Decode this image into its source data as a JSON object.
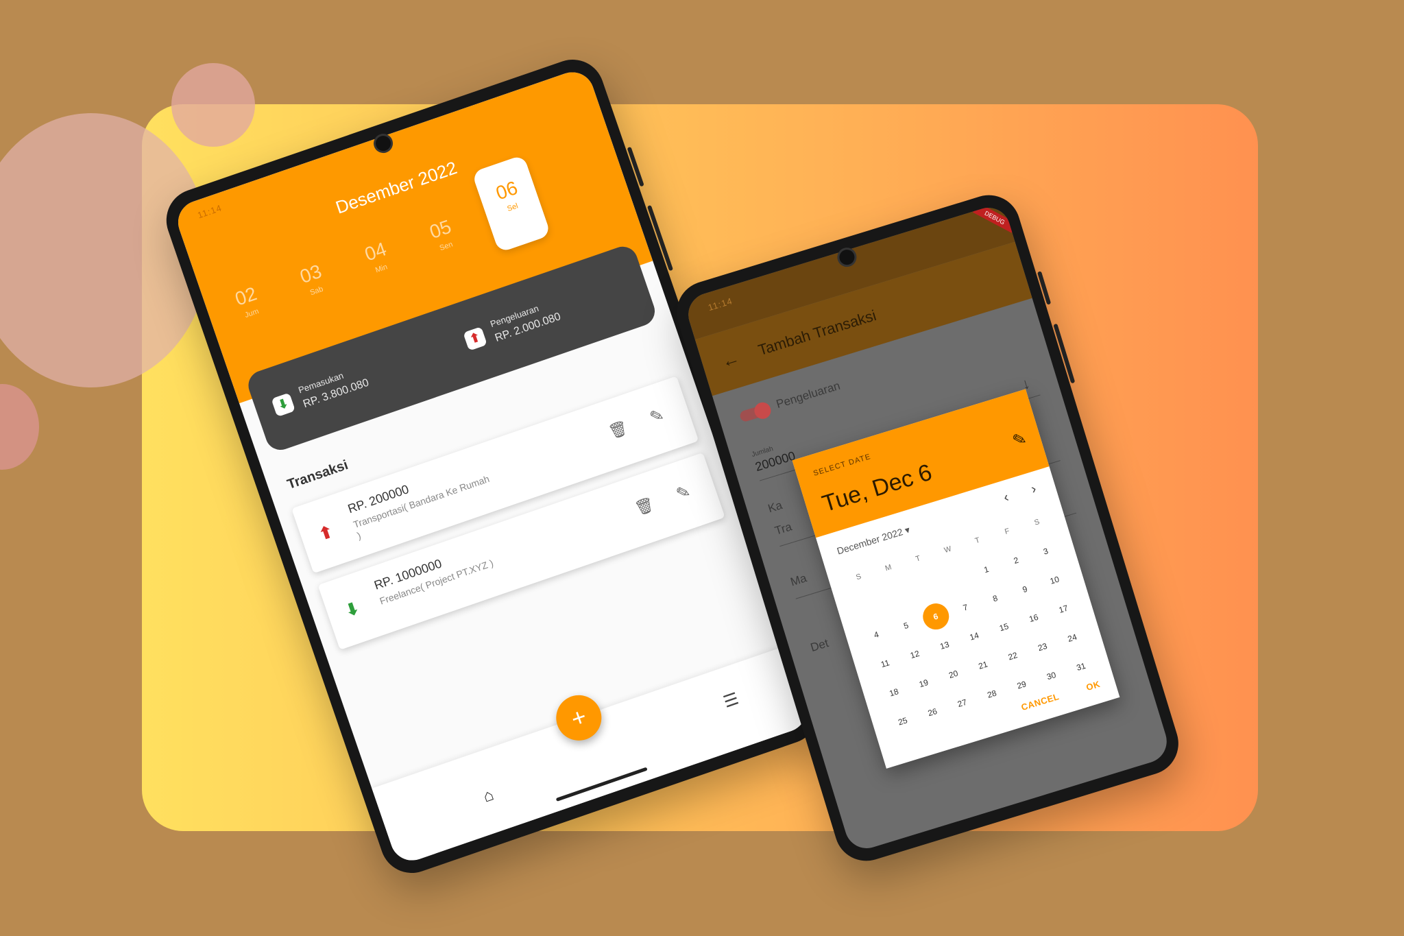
{
  "colors": {
    "background": "#b98a50",
    "accent": "#ff9800",
    "income": "#2e9e3b",
    "expense": "#d62b2b",
    "summary_card": "#454545"
  },
  "phone1": {
    "status_time": "11:14",
    "header": {
      "month": "Desember 2022",
      "days": [
        {
          "num": "02",
          "label": "Jum"
        },
        {
          "num": "03",
          "label": "Sab"
        },
        {
          "num": "04",
          "label": "Min"
        },
        {
          "num": "05",
          "label": "Sen"
        },
        {
          "num": "06",
          "label": "Sel",
          "selected": true
        }
      ]
    },
    "summary": {
      "income_label": "Pemasukan",
      "income_value": "RP. 3.800.080",
      "expense_label": "Pengeluaran",
      "expense_value": "RP. 2.000.080"
    },
    "section_title": "Transaksi",
    "transactions": [
      {
        "type": "expense",
        "amount": "RP. 200000",
        "description": "Transportasi( Bandara Ke Rumah )",
        "icon": "arrow-up-icon"
      },
      {
        "type": "income",
        "amount": "RP. 1000000",
        "description": "Freelance( Project PT.XYZ )",
        "icon": "arrow-down-icon"
      }
    ],
    "fab_label": "+",
    "nav_icons": [
      "home-icon",
      "list-icon"
    ]
  },
  "phone2": {
    "status_time": "11:14",
    "debug_badge": "DEBUG",
    "title": "Tambah Transaksi",
    "toggle_label": "Pengeluaran",
    "amount_label": "Jumlah",
    "amount_value": "200000",
    "bg_fragments": [
      "Ka",
      "Tra",
      "Ma",
      "Det"
    ],
    "date_picker": {
      "header_label": "SELECT DATE",
      "selected_date": "Tue, Dec 6",
      "month_year": "December 2022",
      "weekdays": [
        "S",
        "M",
        "T",
        "W",
        "T",
        "F",
        "S"
      ],
      "weeks": [
        [
          "",
          "",
          "",
          "",
          "1",
          "2",
          "3"
        ],
        [
          "4",
          "5",
          "6",
          "7",
          "8",
          "9",
          "10"
        ],
        [
          "11",
          "12",
          "13",
          "14",
          "15",
          "16",
          "17"
        ],
        [
          "18",
          "19",
          "20",
          "21",
          "22",
          "23",
          "24"
        ],
        [
          "25",
          "26",
          "27",
          "28",
          "29",
          "30",
          "31"
        ]
      ],
      "selected_day": "6",
      "cancel_label": "CANCEL",
      "ok_label": "OK"
    }
  }
}
